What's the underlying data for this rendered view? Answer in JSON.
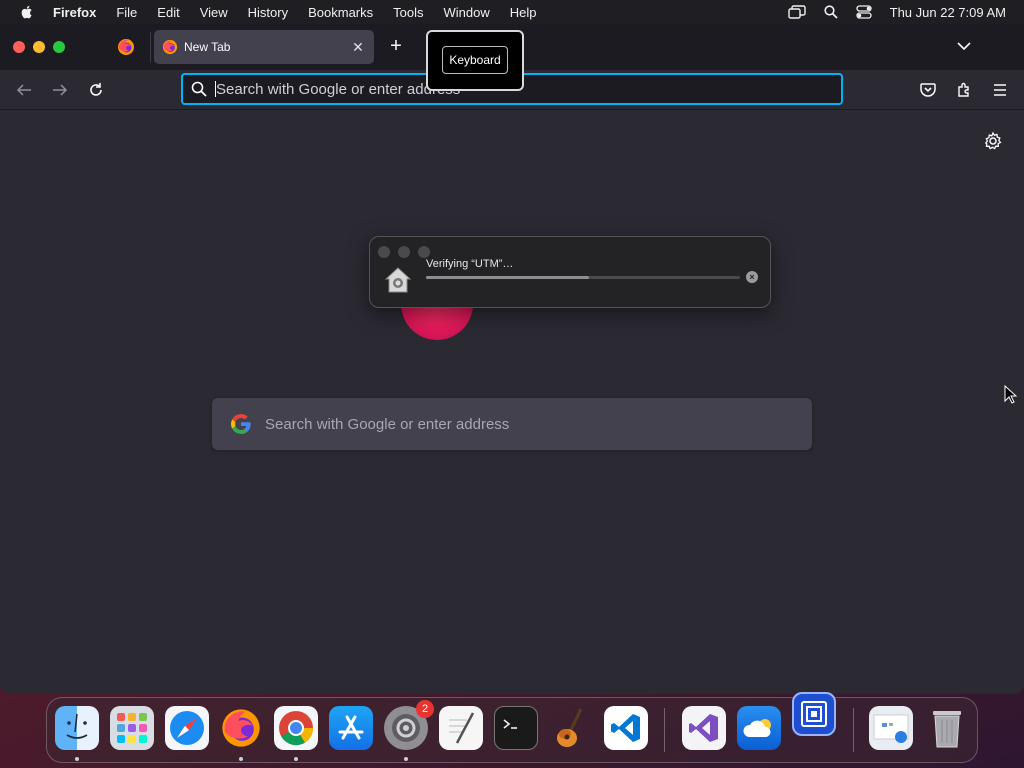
{
  "menubar": {
    "app_name": "Firefox",
    "items": [
      "File",
      "Edit",
      "View",
      "History",
      "Bookmarks",
      "Tools",
      "Window",
      "Help"
    ],
    "clock": "Thu Jun 22  7:09 AM"
  },
  "tabs": {
    "active_tab_title": "New Tab",
    "close_glyph": "✕",
    "new_tab_glyph": "+"
  },
  "tooltip": {
    "label": "Keyboard"
  },
  "urlbar": {
    "placeholder": "Search with Google or enter address"
  },
  "newtab": {
    "search_placeholder": "Search with Google or enter address"
  },
  "verify_dialog": {
    "title": "Verifying “UTM”…",
    "progress": 0.52,
    "cancel_glyph": "×"
  },
  "dock": {
    "apps": [
      "Finder",
      "Launchpad",
      "Safari",
      "Firefox",
      "Google Chrome",
      "App Store",
      "System Settings",
      "TextEdit",
      "Terminal",
      "GarageBand",
      "Visual Studio Code",
      "Visual Studio",
      "iCloud",
      "UTM",
      "Screenshot",
      "Trash"
    ],
    "system_settings_badge": "2"
  },
  "colors": {
    "accent_focus": "#00b3f4",
    "window_bg": "#2b2a33",
    "tab_active": "#42414d"
  }
}
